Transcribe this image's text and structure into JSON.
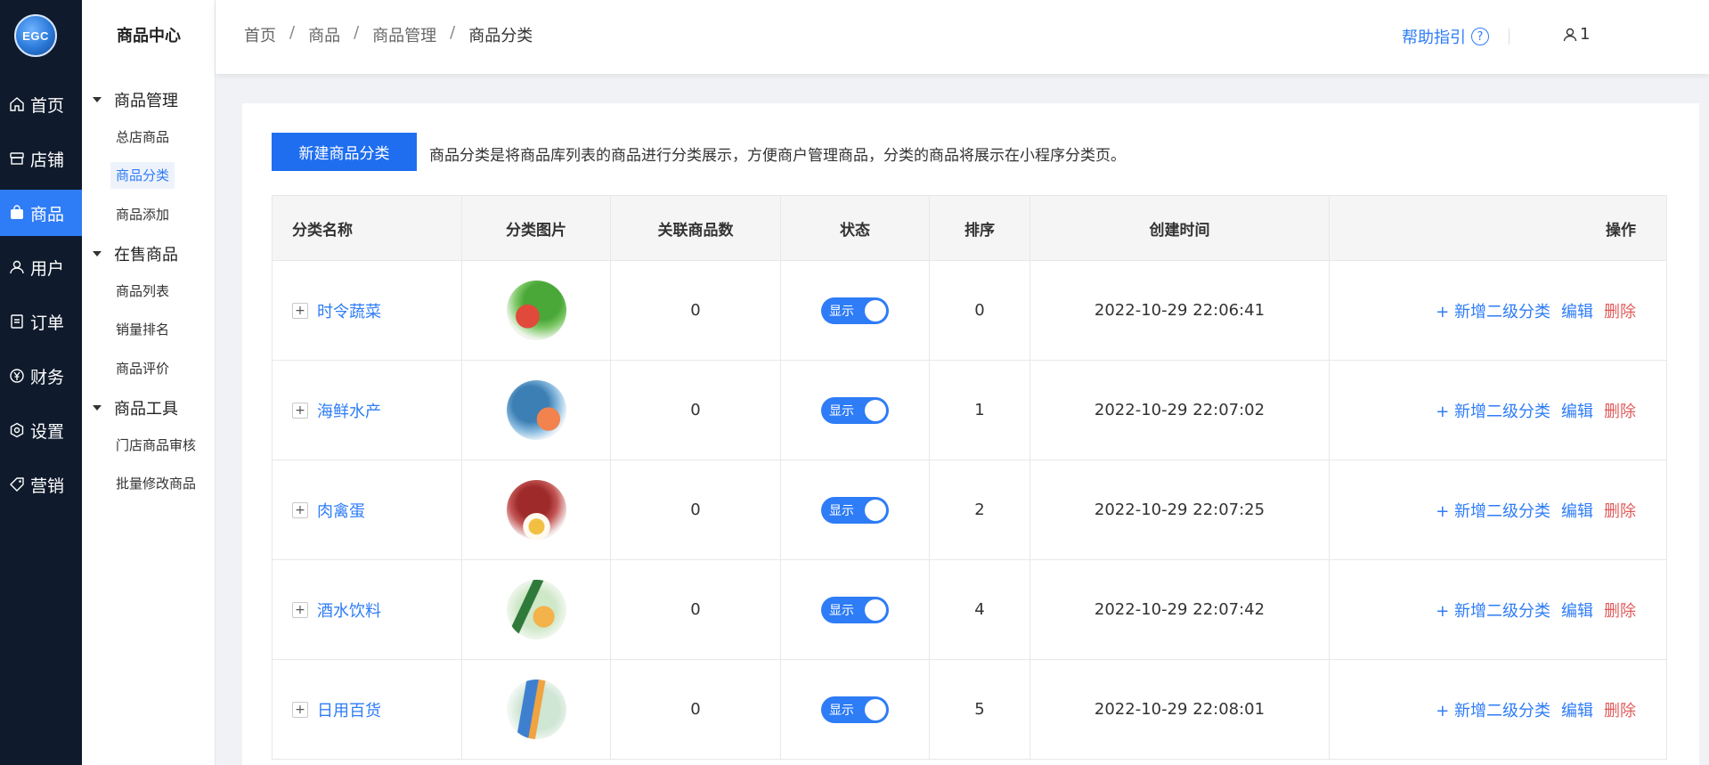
{
  "app": {
    "logo_text": "EGC"
  },
  "rail": {
    "items": [
      {
        "label": "首页",
        "icon": "home-icon"
      },
      {
        "label": "店铺",
        "icon": "shop-icon"
      },
      {
        "label": "商品",
        "icon": "bag-icon",
        "active": true
      },
      {
        "label": "用户",
        "icon": "user-icon"
      },
      {
        "label": "订单",
        "icon": "order-icon"
      },
      {
        "label": "财务",
        "icon": "yen-icon"
      },
      {
        "label": "设置",
        "icon": "settings-icon"
      },
      {
        "label": "营销",
        "icon": "tag-icon"
      }
    ]
  },
  "submenu": {
    "title": "商品中心",
    "groups": [
      {
        "label": "商品管理",
        "items": [
          "总店商品",
          "商品分类",
          "商品添加"
        ]
      },
      {
        "label": "在售商品",
        "items": [
          "商品列表",
          "销量排名",
          "商品评价"
        ]
      },
      {
        "label": "商品工具",
        "items": [
          "门店商品审核",
          "批量修改商品"
        ]
      }
    ],
    "active_item": "商品分类"
  },
  "header": {
    "breadcrumb": [
      "首页",
      "商品",
      "商品管理",
      "商品分类"
    ],
    "help_label": "帮助指引",
    "help_icon": "question-circle-icon",
    "user_label": "1",
    "user_icon": "user-outline-icon"
  },
  "toolbar": {
    "new_button": "新建商品分类",
    "description": "商品分类是将商品库列表的商品进行分类展示，方便商户管理商品，分类的商品将展示在小程序分类页。"
  },
  "table": {
    "columns": [
      "分类名称",
      "分类图片",
      "关联商品数",
      "状态",
      "排序",
      "创建时间",
      "操作"
    ],
    "rows": [
      {
        "name": "时令蔬菜",
        "count": "0",
        "status": "显示",
        "sort": "0",
        "created": "2022-10-29 22:06:41"
      },
      {
        "name": "海鲜水产",
        "count": "0",
        "status": "显示",
        "sort": "1",
        "created": "2022-10-29 22:07:02"
      },
      {
        "name": "肉禽蛋",
        "count": "0",
        "status": "显示",
        "sort": "2",
        "created": "2022-10-29 22:07:25"
      },
      {
        "name": "酒水饮料",
        "count": "0",
        "status": "显示",
        "sort": "4",
        "created": "2022-10-29 22:07:42"
      },
      {
        "name": "日用百货",
        "count": "0",
        "status": "显示",
        "sort": "5",
        "created": "2022-10-29 22:08:01"
      }
    ],
    "actions": {
      "add_sub": "+ 新增二级分类",
      "edit": "编辑",
      "delete": "删除"
    },
    "expand_symbol": "+"
  },
  "colors": {
    "primary": "#2e7cf6",
    "danger": "#e05a5a",
    "rail_bg": "#0f1b2c"
  }
}
